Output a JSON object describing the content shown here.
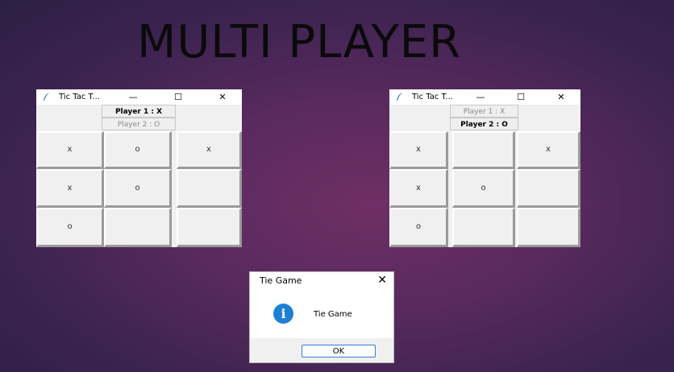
{
  "headline": "MULTI PLAYER",
  "windows": [
    {
      "title": "Tic Tac T...",
      "controls": {
        "minimize": "—",
        "maximize": "☐",
        "close": "✕"
      },
      "player1_label": "Player 1 : X",
      "player2_label": "Player 2 : O",
      "active_player": 1,
      "board": [
        [
          "x",
          "o",
          "x"
        ],
        [
          "x",
          "o",
          ""
        ],
        [
          "o",
          "",
          ""
        ]
      ]
    },
    {
      "title": "Tic Tac T...",
      "controls": {
        "minimize": "—",
        "maximize": "☐",
        "close": "✕"
      },
      "player1_label": "Player 1 : X",
      "player2_label": "Player 2 : O",
      "active_player": 2,
      "board": [
        [
          "x",
          "",
          "x"
        ],
        [
          "x",
          "o",
          ""
        ],
        [
          "o",
          "",
          ""
        ]
      ]
    }
  ],
  "dialog": {
    "title": "Tie Game",
    "close": "✕",
    "icon": "info-icon",
    "message": "Tie Game",
    "ok_label": "OK"
  },
  "colors": {
    "info_icon": "#1e7fd6",
    "ok_border": "#3a7bd5"
  }
}
